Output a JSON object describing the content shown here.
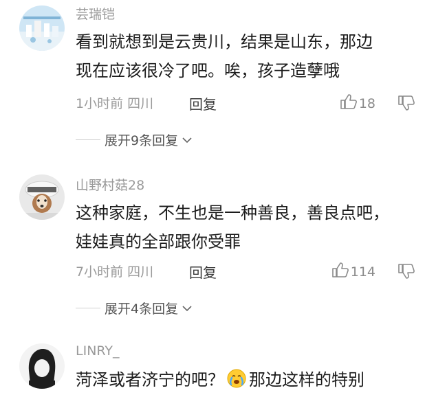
{
  "comments": [
    {
      "username": "芸瑞铠",
      "lines": [
        "看到就想到是云贵川，结果是山东，那边",
        "现在应该很冷了吧。唉，孩子造孽哦"
      ],
      "time_location": "1小时前 四川",
      "reply_label": "回复",
      "likes": "18",
      "expand_label": "展开9条回复"
    },
    {
      "username": "山野村菇28",
      "lines": [
        "这种家庭，不生也是一种善良，善良点吧，",
        "娃娃真的全部跟你受罪"
      ],
      "time_location": "7小时前 四川",
      "reply_label": "回复",
      "likes": "114",
      "expand_label": "展开4条回复"
    },
    {
      "username": "LINRY_",
      "line_before_emoji": "菏泽或者济宁的吧？",
      "line_after_emoji": "那边这样的特别",
      "emoji_icon": "crying-face-emoji"
    }
  ],
  "colors": {
    "meta_gray": "#9a9a9a",
    "text": "#1c1c1c",
    "reply_text": "#3a3a3a"
  },
  "icons": [
    "thumbs-up-icon",
    "thumbs-down-icon",
    "chevron-down-icon"
  ]
}
